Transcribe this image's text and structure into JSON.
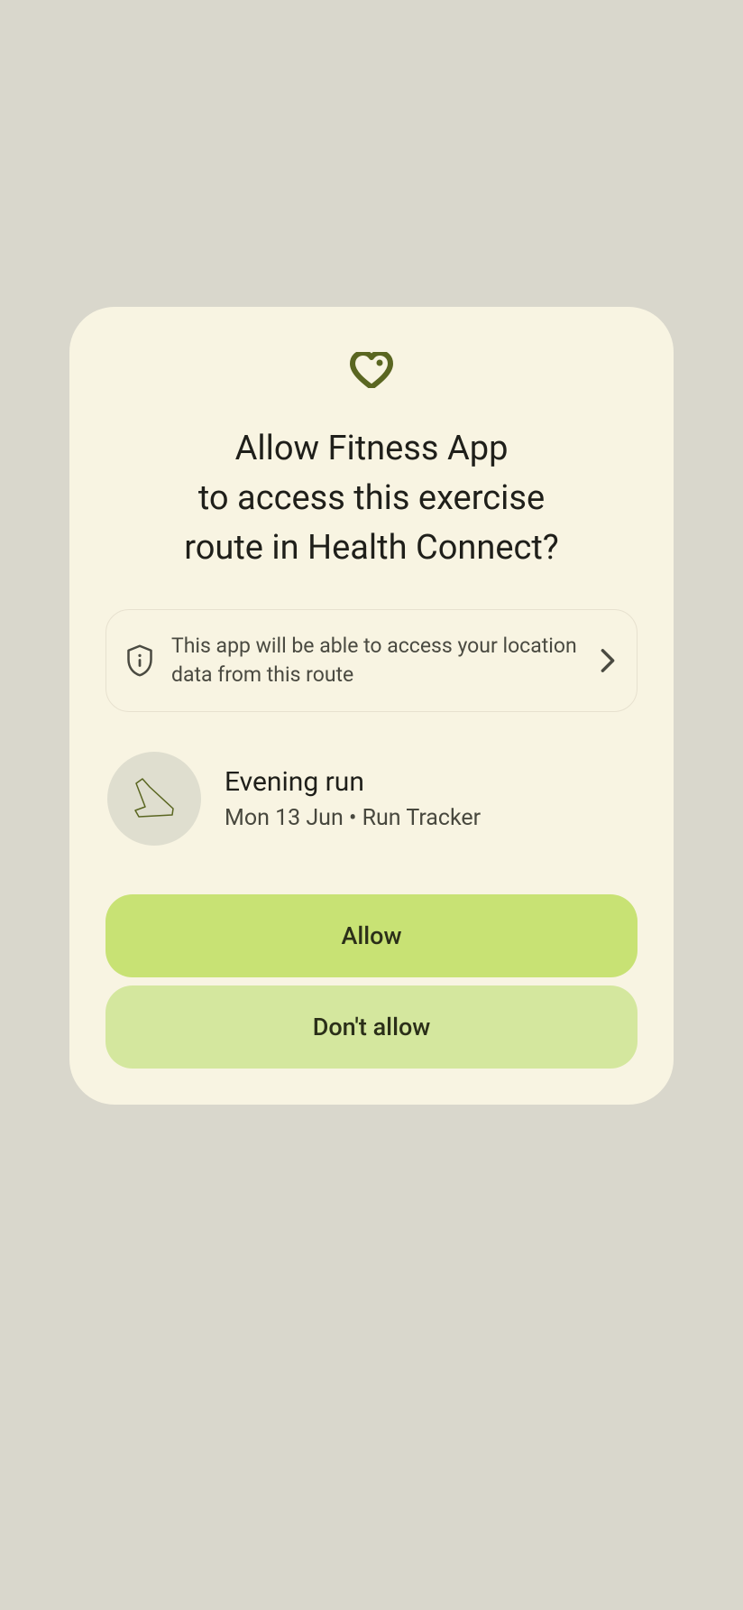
{
  "dialog": {
    "title": "Allow Fitness App\nto access this exercise\nroute in Health Connect?",
    "info_banner": {
      "text": "This app will be able to access your location data from this route"
    },
    "route": {
      "title": "Evening run",
      "subtitle": "Mon 13 Jun  •  Run Tracker"
    },
    "buttons": {
      "allow": "Allow",
      "dont_allow": "Don't allow"
    }
  },
  "colors": {
    "accent": "#5a6621",
    "button_primary": "#c8e274",
    "button_secondary": "#d4e79e",
    "dialog_bg": "#f8f4e2",
    "screen_bg": "#d9d7cc"
  }
}
